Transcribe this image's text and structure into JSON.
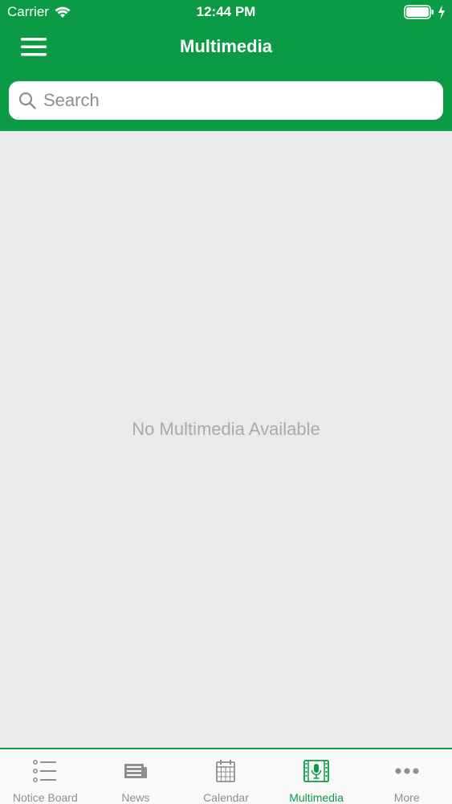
{
  "status_bar": {
    "carrier": "Carrier",
    "time": "12:44 PM"
  },
  "nav": {
    "title": "Multimedia",
    "menu_icon": "hamburger-menu-icon"
  },
  "search": {
    "placeholder": "Search",
    "value": ""
  },
  "content": {
    "empty_message": "No Multimedia Available"
  },
  "tabs": [
    {
      "label": "Notice Board",
      "icon": "list-icon",
      "active": false
    },
    {
      "label": "News",
      "icon": "newspaper-icon",
      "active": false
    },
    {
      "label": "Calendar",
      "icon": "calendar-icon",
      "active": false
    },
    {
      "label": "Multimedia",
      "icon": "microphone-film-icon",
      "active": true
    },
    {
      "label": "More",
      "icon": "ellipsis-icon",
      "active": false
    }
  ],
  "colors": {
    "brand": "#0b9b45",
    "background": "#ebeaeb",
    "inactive": "#8e8e93"
  }
}
